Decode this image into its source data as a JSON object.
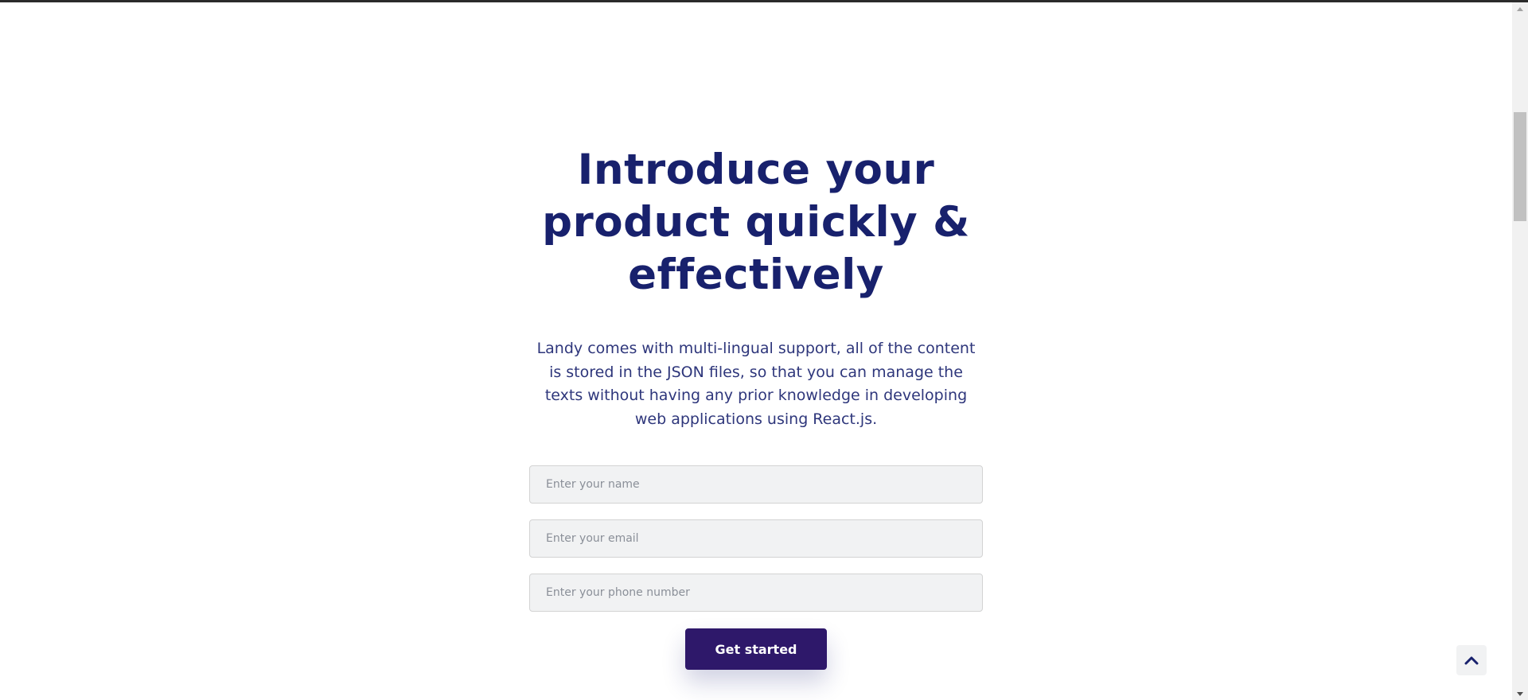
{
  "hero": {
    "title": "Introduce your product quickly & effectively",
    "description": "Landy comes with multi-lingual support, all of the content is stored in the JSON files, so that you can manage the texts without having any prior knowledge in developing web applications using React.js."
  },
  "form": {
    "name_placeholder": "Enter your name",
    "email_placeholder": "Enter your email",
    "phone_placeholder": "Enter your phone number",
    "name_value": "",
    "email_value": "",
    "phone_value": "",
    "submit_label": "Get started"
  },
  "scroll_top": {
    "icon": "chevron-up-icon"
  },
  "colors": {
    "heading": "#18216d",
    "button": "#2e186a",
    "field_background": "#f1f2f3"
  }
}
